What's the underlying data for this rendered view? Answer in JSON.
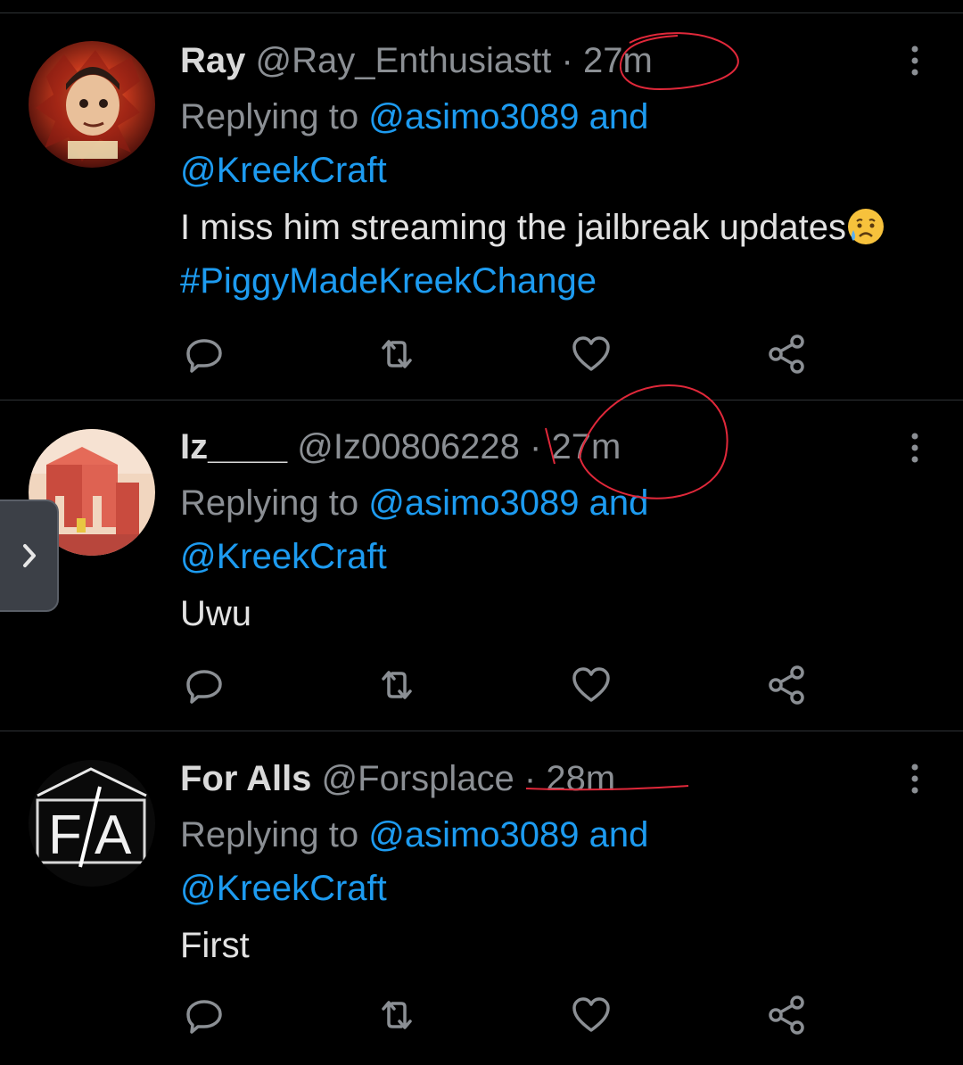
{
  "tweets": [
    {
      "name": "Ray",
      "handle": "@Ray_Enthusiastt",
      "separator": "·",
      "time": "27m",
      "replying_prefix": "Replying to",
      "reply_to_1": "@asimo3089",
      "and": "and",
      "reply_to_2": "@KreekCraft",
      "body": "I miss him streaming the jailbreak updates",
      "emoji": "sad-but-relieved-face-emoji",
      "hashtag": "#PiggyMadeKreekChange"
    },
    {
      "name": "Iz____",
      "handle": "@Iz00806228",
      "separator": "·",
      "time": "27m",
      "replying_prefix": "Replying to",
      "reply_to_1": "@asimo3089",
      "and": "and",
      "reply_to_2": "@KreekCraft",
      "body": "Uwu"
    },
    {
      "name": "For Alls",
      "handle": "@Forsplace",
      "separator": "·",
      "time": "28m",
      "replying_prefix": "Replying to",
      "reply_to_1": "@asimo3089",
      "and": "and",
      "reply_to_2": "@KreekCraft",
      "body": "First"
    }
  ],
  "icons": {
    "reply": "reply-icon",
    "retweet": "retweet-icon",
    "like": "like-icon",
    "share": "share-icon",
    "more": "more-options-icon",
    "side_tab": "chevron-right-icon"
  },
  "colors": {
    "background": "#000000",
    "text": "#d9d9d9",
    "muted": "#8b8f94",
    "link": "#1d9bf0",
    "divider": "#2f3336",
    "annotation": "#e0283a"
  }
}
